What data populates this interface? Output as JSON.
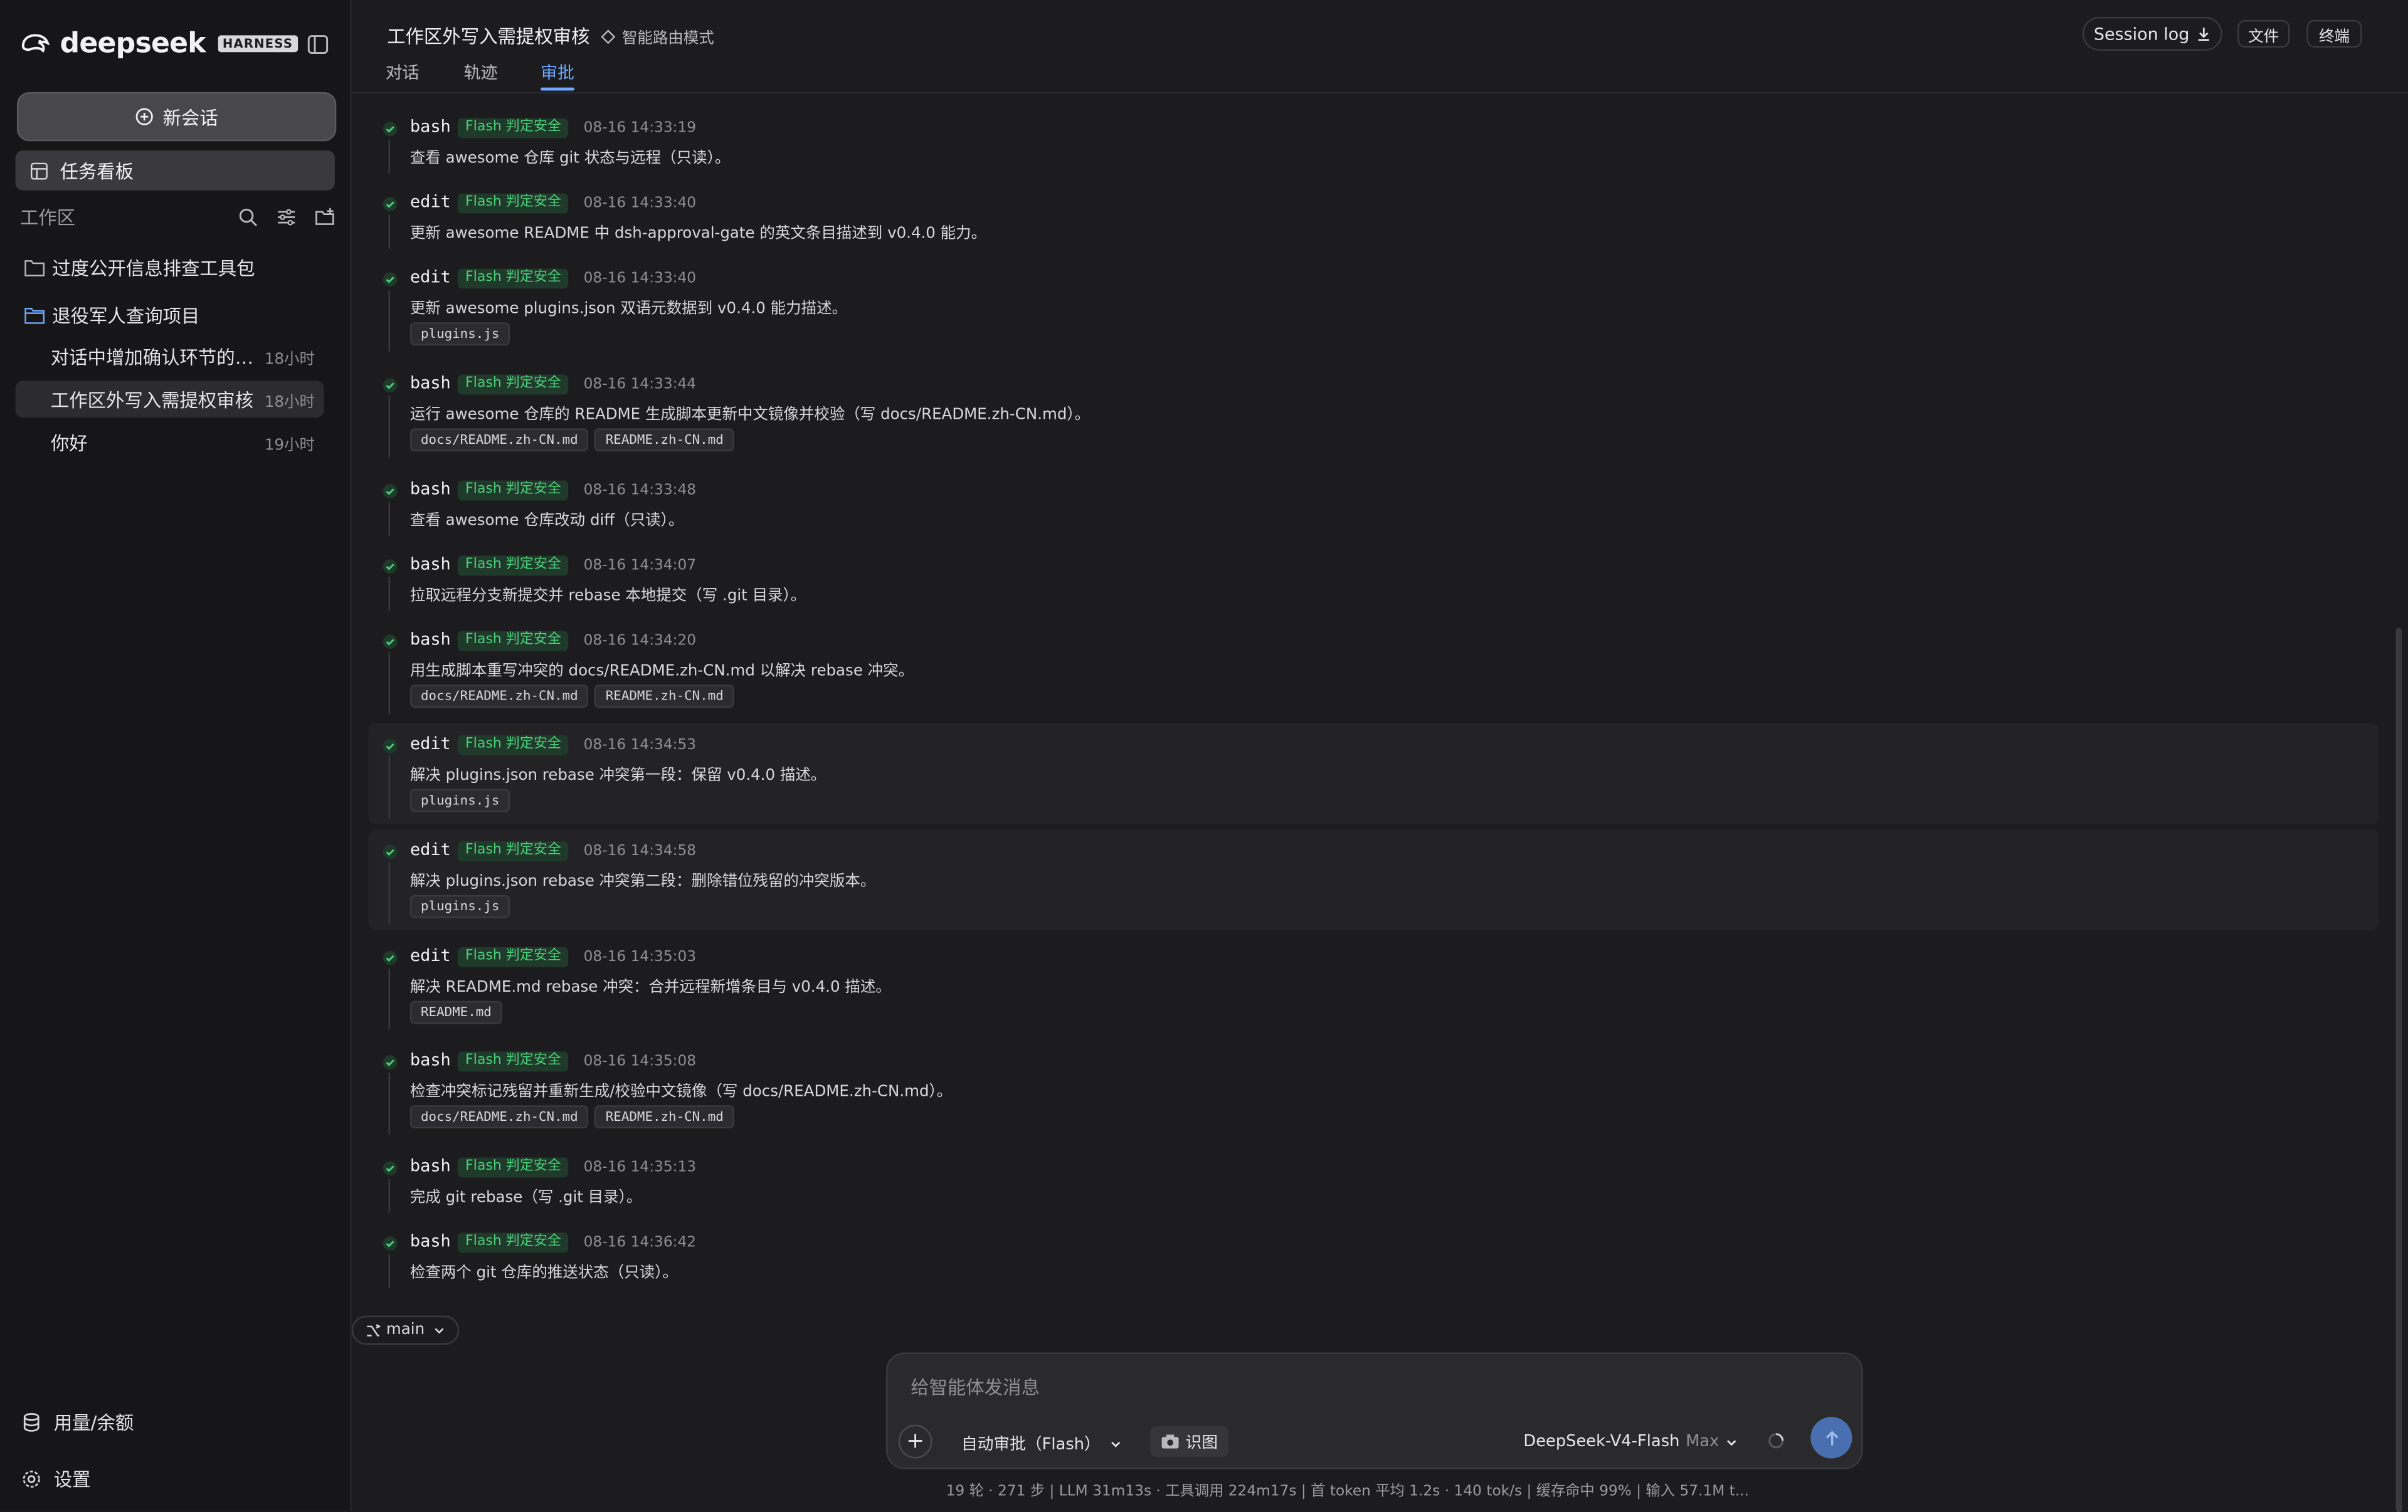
{
  "colors": {
    "background": "#1c1c1e",
    "sidebar": "#161618",
    "accent": "#6ea8ff",
    "safe_badge_text": "#4ccf7a",
    "safe_badge_bg": "#1f3a2a",
    "send_button": "#4a6fb0"
  },
  "brand": {
    "name": "deepseek",
    "tag": "HARNESS",
    "logo_icon": "whale-icon"
  },
  "sidebar": {
    "new_chat": "新会话",
    "task_board": "任务看板",
    "workspace_label": "工作区",
    "folders": [
      {
        "name": "过度公开信息排查工具包",
        "icon": "folder-icon"
      },
      {
        "name": "退役军人查询项目",
        "icon": "folder-open-icon"
      }
    ],
    "sessions": [
      {
        "title": "对话中增加确认环节的插件",
        "display": "对话中增加确认环节的插...",
        "time": "18小时"
      },
      {
        "title": "工作区外写入需提权审核",
        "display": "工作区外写入需提权审核",
        "time": "18小时",
        "active": true
      },
      {
        "title": "你好",
        "display": "你好",
        "time": "19小时"
      }
    ],
    "usage": "用量/余额",
    "settings": "设置"
  },
  "header": {
    "title": "工作区外写入需提权审核",
    "route_mode": "智能路由模式",
    "tabs": [
      "对话",
      "轨迹",
      "审批"
    ],
    "active_tab": "审批",
    "session_log": "Session log",
    "files": "文件",
    "terminal": "终端"
  },
  "approvals": [
    {
      "tool": "bash",
      "badge": "Flash 判定安全",
      "time": "08-16 14:33:19",
      "desc": "查看 awesome 仓库 git 状态与远程（只读）。",
      "files": []
    },
    {
      "tool": "edit",
      "badge": "Flash 判定安全",
      "time": "08-16 14:33:40",
      "desc": "更新 awesome README 中 dsh-approval-gate 的英文条目描述到 v0.4.0 能力。",
      "files": []
    },
    {
      "tool": "edit",
      "badge": "Flash 判定安全",
      "time": "08-16 14:33:40",
      "desc": "更新 awesome plugins.json 双语元数据到 v0.4.0 能力描述。",
      "files": [
        "plugins.js"
      ]
    },
    {
      "tool": "bash",
      "badge": "Flash 判定安全",
      "time": "08-16 14:33:44",
      "desc": "运行 awesome 仓库的 README 生成脚本更新中文镜像并校验（写 docs/README.zh-CN.md）。",
      "files": [
        "docs/README.zh-CN.md",
        "README.zh-CN.md"
      ]
    },
    {
      "tool": "bash",
      "badge": "Flash 判定安全",
      "time": "08-16 14:33:48",
      "desc": "查看 awesome 仓库改动 diff（只读）。",
      "files": []
    },
    {
      "tool": "bash",
      "badge": "Flash 判定安全",
      "time": "08-16 14:34:07",
      "desc": "拉取远程分支新提交并 rebase 本地提交（写 .git 目录）。",
      "files": []
    },
    {
      "tool": "bash",
      "badge": "Flash 判定安全",
      "time": "08-16 14:34:20",
      "desc": "用生成脚本重写冲突的 docs/README.zh-CN.md 以解决 rebase 冲突。",
      "files": [
        "docs/README.zh-CN.md",
        "README.zh-CN.md"
      ]
    },
    {
      "tool": "edit",
      "badge": "Flash 判定安全",
      "time": "08-16 14:34:53",
      "desc": "解决 plugins.json rebase 冲突第一段：保留 v0.4.0 描述。",
      "files": [
        "plugins.js"
      ]
    },
    {
      "tool": "edit",
      "badge": "Flash 判定安全",
      "time": "08-16 14:34:58",
      "desc": "解决 plugins.json rebase 冲突第二段：删除错位残留的冲突版本。",
      "files": [
        "plugins.js"
      ]
    },
    {
      "tool": "edit",
      "badge": "Flash 判定安全",
      "time": "08-16 14:35:03",
      "desc": "解决 README.md rebase 冲突：合并远程新增条目与 v0.4.0 描述。",
      "files": [
        "README.md"
      ]
    },
    {
      "tool": "bash",
      "badge": "Flash 判定安全",
      "time": "08-16 14:35:08",
      "desc": "检查冲突标记残留并重新生成/校验中文镜像（写 docs/README.zh-CN.md）。",
      "files": [
        "docs/README.zh-CN.md",
        "README.zh-CN.md"
      ]
    },
    {
      "tool": "bash",
      "badge": "Flash 判定安全",
      "time": "08-16 14:35:13",
      "desc": "完成 git rebase（写 .git 目录）。",
      "files": []
    },
    {
      "tool": "bash",
      "badge": "Flash 判定安全",
      "time": "08-16 14:36:42",
      "desc": "检查两个 git 仓库的推送状态（只读）。",
      "files": []
    }
  ],
  "branch": "main",
  "composer": {
    "placeholder": "给智能体发消息",
    "approval_mode": "自动审批（Flash）",
    "ocr": "识图",
    "model": "DeepSeek-V4-Flash",
    "model_tier": "Max"
  },
  "status_line": "19 轮 · 271 步  |  LLM 31m13s · 工具调用 224m17s  |  首 token 平均 1.2s · 140 tok/s  |  缓存命中 99%  |  输入 57.1M t..."
}
